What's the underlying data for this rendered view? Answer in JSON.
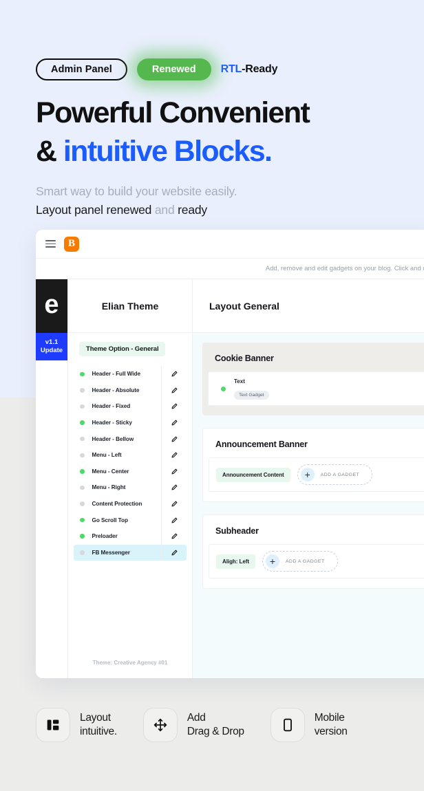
{
  "hero": {
    "badge_outline": "Admin Panel",
    "badge_green": "Renewed",
    "rtl_prefix": "RTL",
    "rtl_suffix": "-Ready",
    "title_line1": "Powerful Convenient",
    "title_amp": "&",
    "title_blue": "intuitive Blocks.",
    "sub_line1": "Smart way to build your website easily.",
    "sub2_a": "Layout panel renewed",
    "sub2_muted": " and ",
    "sub2_b": "ready",
    "colors": {
      "blue": "#1b5cff",
      "green": "#55b84e",
      "bg_blue": "#e9effc",
      "bg_gray": "#ececeb"
    }
  },
  "app": {
    "topbar": {
      "menu_icon": "hamburger-icon",
      "logo_letter": "B",
      "logo_color": "#f57c00"
    },
    "helper_text": "Add, remove and edit gadgets on your blog. Click and drag to",
    "brand": {
      "mark_letter": "e",
      "update_line1": "v1.1",
      "update_line2": "Update",
      "update_color": "#1f3bff"
    },
    "theme_panel": {
      "title": "Elian Theme",
      "section_pill": "Theme Option - General",
      "footer": "Theme: Creative Agency #01",
      "edit_icon": "pencil-icon",
      "options": [
        {
          "label": "Header - Full Wide",
          "on": true,
          "selected": false
        },
        {
          "label": "Header - Absolute",
          "on": false,
          "selected": false
        },
        {
          "label": "Header - Fixed",
          "on": false,
          "selected": false
        },
        {
          "label": "Header - Sticky",
          "on": true,
          "selected": false
        },
        {
          "label": "Header - Bellow",
          "on": false,
          "selected": false
        },
        {
          "label": "Menu - Left",
          "on": false,
          "selected": false
        },
        {
          "label": "Menu - Center",
          "on": true,
          "selected": false
        },
        {
          "label": "Menu - Right",
          "on": false,
          "selected": false
        },
        {
          "label": "Content Protection",
          "on": false,
          "selected": false
        },
        {
          "label": "Go Scroll Top",
          "on": true,
          "selected": false
        },
        {
          "label": "Preloader",
          "on": true,
          "selected": false
        },
        {
          "label": "FB Messenger",
          "on": false,
          "selected": true
        }
      ]
    },
    "layout": {
      "title": "Layout General",
      "sections": [
        {
          "title": "Cookie Banner",
          "style": "beige",
          "gadget_title": "Text",
          "gadget_chip": "Text Gadget"
        },
        {
          "title": "Announcement Banner",
          "style": "white",
          "green_chip": "Announcement Content",
          "add_label": "ADD A GADGET",
          "add_icon": "plus-icon"
        },
        {
          "title": "Subheader",
          "style": "white",
          "green_chip": "Aligh: Left",
          "add_label": "ADD A GADGET",
          "add_icon": "plus-icon"
        }
      ]
    }
  },
  "features": [
    {
      "icon": "layout-blocks-icon",
      "line1": "Layout",
      "line2": "intuitive."
    },
    {
      "icon": "move-arrows-icon",
      "line1": "Add",
      "line2": "Drag & Drop"
    },
    {
      "icon": "mobile-phone-icon",
      "line1": "Mobile",
      "line2": "version"
    }
  ]
}
